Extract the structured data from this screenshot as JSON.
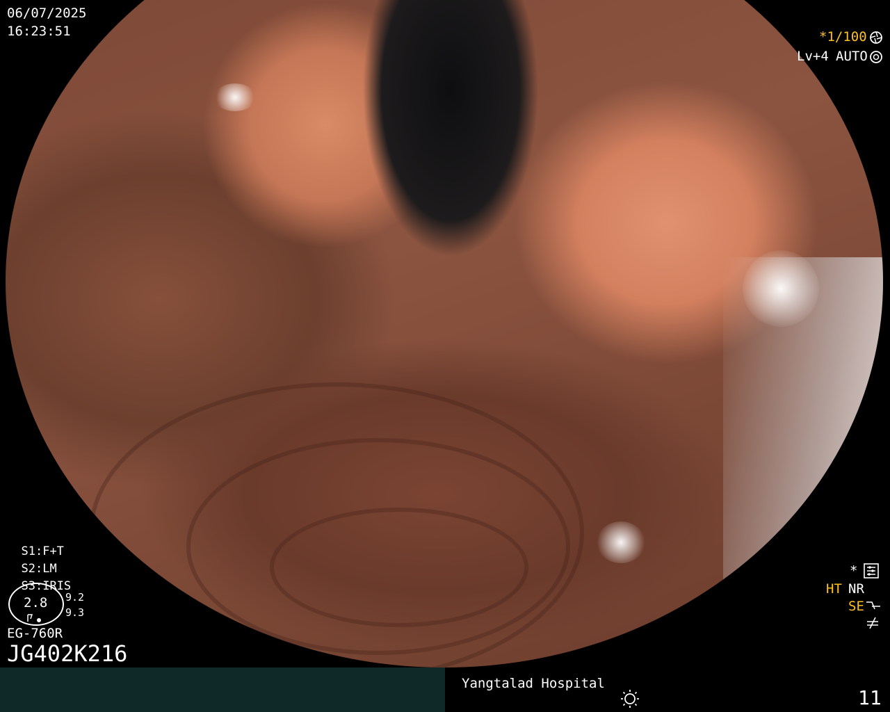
{
  "timestamp": {
    "date": "06/07/2025",
    "time": "16:23:51"
  },
  "top_right": {
    "shutter": "*1/100",
    "shutter_icon": "shutter-icon",
    "level": "Lv+4",
    "exposure": "AUTO",
    "exposure_icon": "auto-exposure-icon"
  },
  "settings": {
    "s1_key": "S1:",
    "s1_val": "F+T",
    "s2_key": "S2:",
    "s2_val": "LM",
    "s3_key": "S3:",
    "s3_val": "IRIS",
    "zoom": "2.8",
    "ratio_top": "9.2",
    "ratio_bottom": "9.3"
  },
  "scope": {
    "model": "EG-760R",
    "serial": "JG402K216"
  },
  "bottom_right_status": {
    "star_label": "*",
    "ht": "HT",
    "nr": "NR",
    "se": "SE"
  },
  "footer": {
    "hospital": "Yangtalad Hospital",
    "image_number": "11",
    "light_icon": "light-source-icon"
  },
  "colors": {
    "accent_yellow": "#ffc020",
    "footer_bg": "#0e2928",
    "text": "#ffffff"
  }
}
